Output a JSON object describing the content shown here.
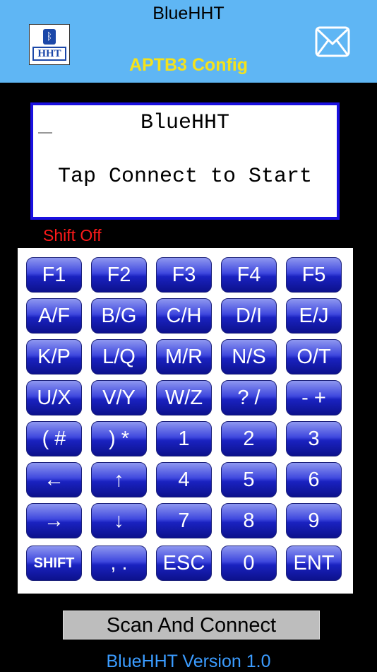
{
  "header": {
    "app_title": "BlueHHT",
    "config_title": "APTB3 Config",
    "logo_text": "HHT",
    "logo_icon": "bluetooth-icon",
    "mail_icon": "mail-icon",
    "bluetooth_glyph": "ᛒ"
  },
  "display": {
    "line1": "BlueHHT",
    "line2": "Tap Connect to Start"
  },
  "status": {
    "shift": "Shift Off"
  },
  "keypad": {
    "rows": [
      [
        "F1",
        "F2",
        "F3",
        "F4",
        "F5"
      ],
      [
        "A/F",
        "B/G",
        "C/H",
        "D/I",
        "E/J"
      ],
      [
        "K/P",
        "L/Q",
        "M/R",
        "N/S",
        "O/T"
      ],
      [
        "U/X",
        "V/Y",
        "W/Z",
        "? /",
        "- +"
      ],
      [
        "( #",
        ") *",
        "1",
        "2",
        "3"
      ],
      [
        "←",
        "↑",
        "4",
        "5",
        "6"
      ],
      [
        "→",
        "↓",
        "7",
        "8",
        "9"
      ],
      [
        "SHIFT",
        ", .",
        "ESC",
        "0",
        "ENT"
      ]
    ]
  },
  "footer": {
    "scan_button": "Scan And Connect",
    "version": "BlueHHT Version 1.0"
  },
  "colors": {
    "header_bg": "#5fb6f4",
    "config_title": "#f4e21c",
    "screen_border": "#1a10e0",
    "shift_text": "#ff1a1a",
    "key_blue": "#1a22c0",
    "version_text": "#3b9cff"
  }
}
